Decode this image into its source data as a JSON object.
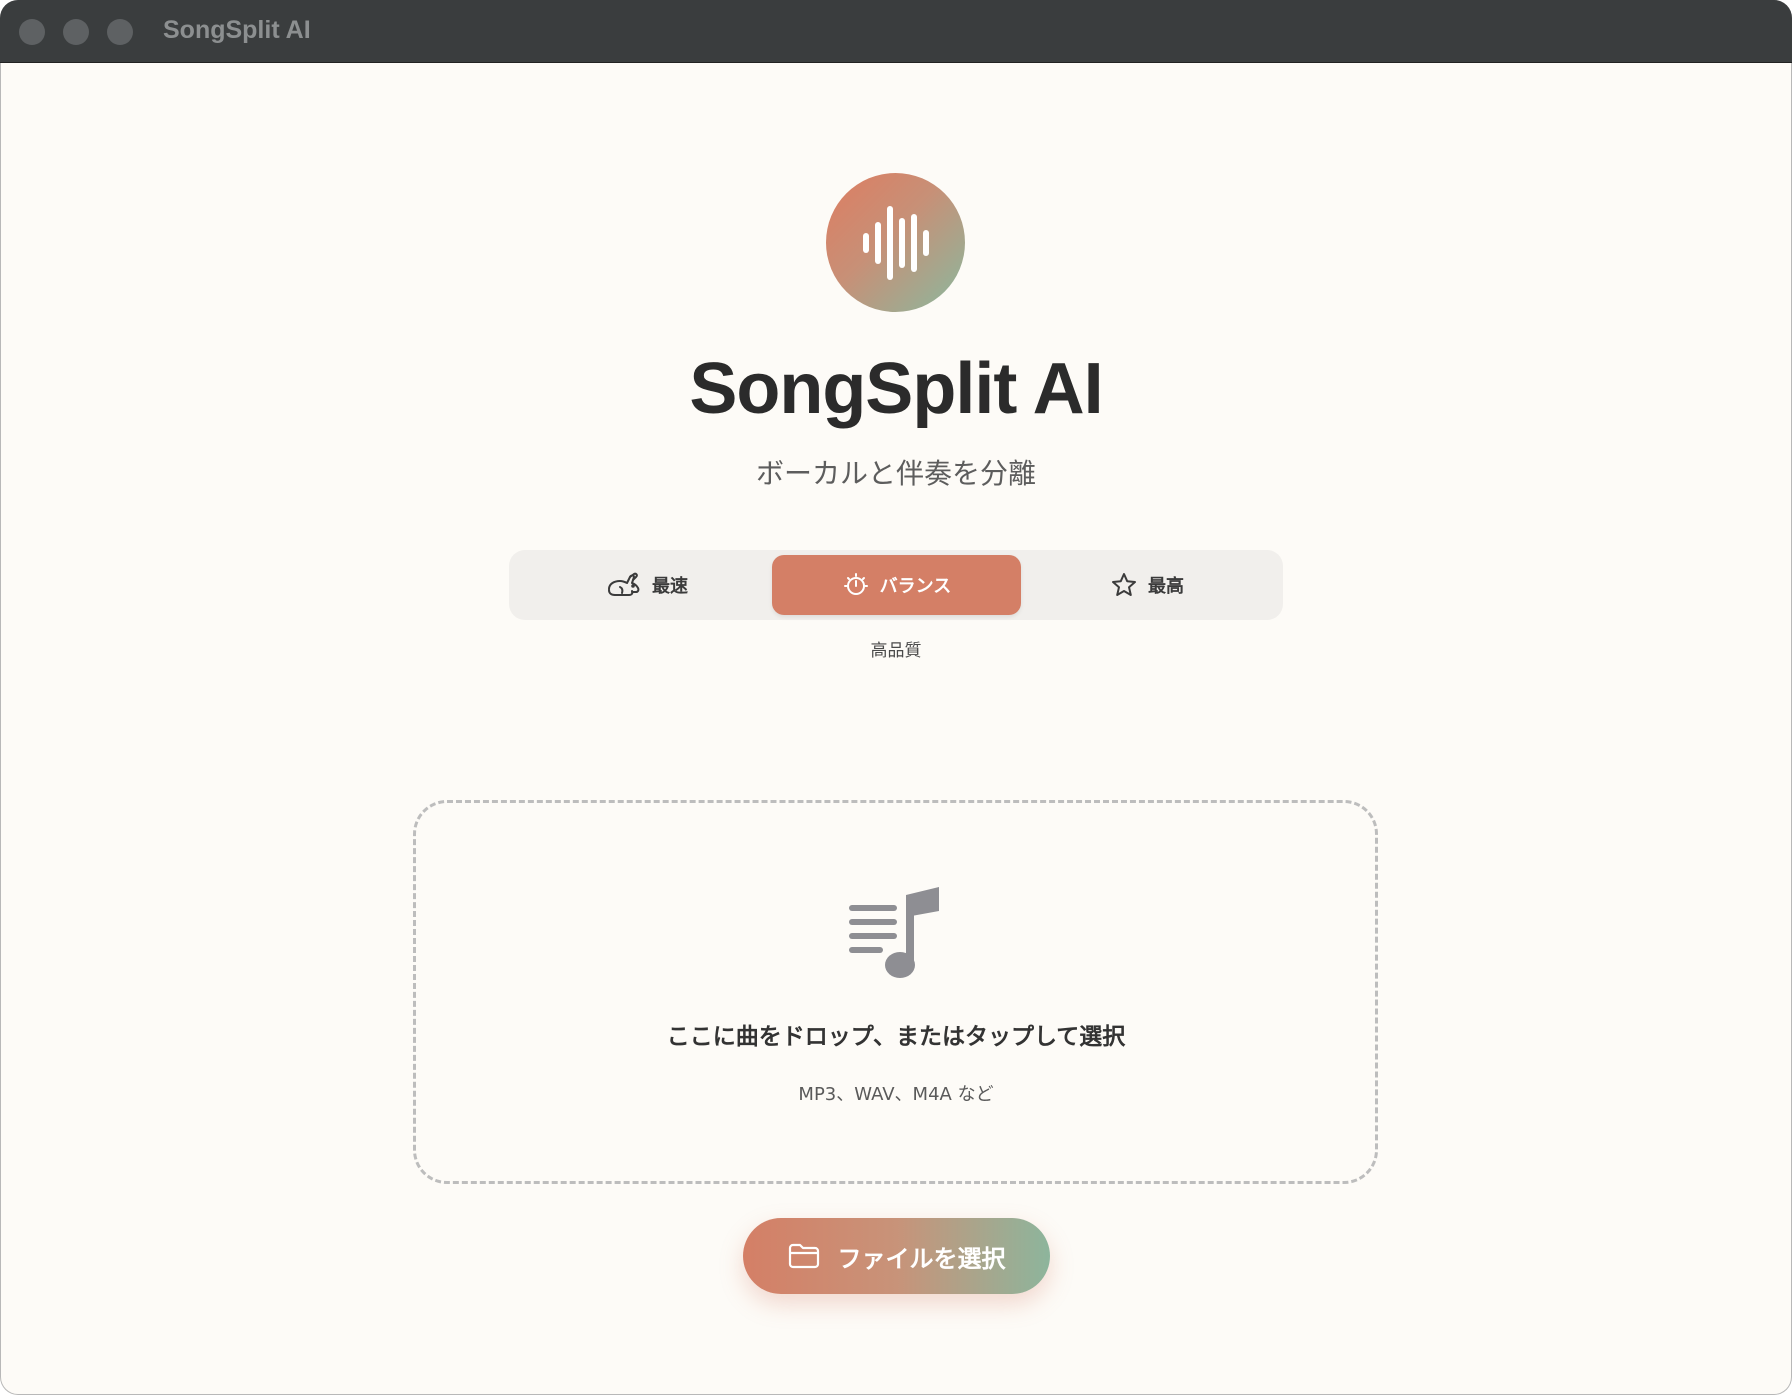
{
  "window": {
    "title": "SongSplit AI"
  },
  "header": {
    "app_name": "SongSplit AI",
    "subtitle": "ボーカルと伴奏を分離",
    "logo_icon": "waveform-icon"
  },
  "quality_selector": {
    "options": [
      {
        "label": "最速",
        "icon": "rabbit-icon",
        "selected": false
      },
      {
        "label": "バランス",
        "icon": "timer-icon",
        "selected": true
      },
      {
        "label": "最高",
        "icon": "star-icon",
        "selected": false
      }
    ],
    "caption": "高品質"
  },
  "dropzone": {
    "icon": "music-list-icon",
    "title": "ここに曲をドロップ、またはタップして選択",
    "formats": "MP3、WAV、M4A など"
  },
  "choose_button": {
    "label": "ファイルを選択",
    "icon": "folder-icon"
  },
  "colors": {
    "accent": "#d47f66",
    "accent_secondary": "#8db59c",
    "background": "#fdfbf7",
    "titlebar": "#3a3d3e"
  }
}
